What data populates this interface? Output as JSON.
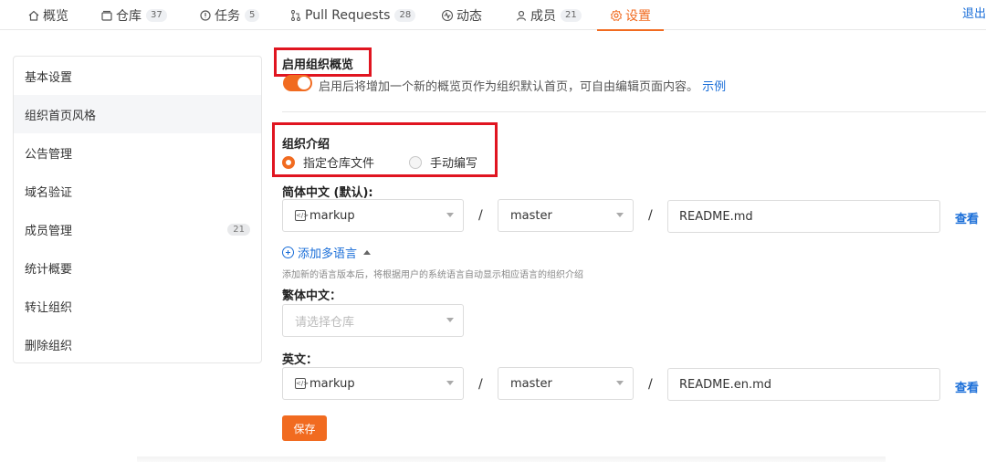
{
  "nav": {
    "tabs": [
      {
        "label": "概览",
        "icon": "home-icon",
        "count": ""
      },
      {
        "label": "仓库",
        "icon": "repo-icon",
        "count": "37"
      },
      {
        "label": "任务",
        "icon": "issue-icon",
        "count": "5"
      },
      {
        "label": "Pull Requests",
        "icon": "pull-request-icon",
        "count": "28"
      },
      {
        "label": "动态",
        "icon": "activity-icon",
        "count": ""
      },
      {
        "label": "成员",
        "icon": "user-icon",
        "count": "21"
      },
      {
        "label": "设置",
        "icon": "gear-icon",
        "count": ""
      }
    ],
    "logout": "退出"
  },
  "sidebar": {
    "items": [
      {
        "label": "基本设置"
      },
      {
        "label": "组织首页风格"
      },
      {
        "label": "公告管理"
      },
      {
        "label": "域名验证"
      },
      {
        "label": "成员管理",
        "count": "21"
      },
      {
        "label": "统计概要"
      },
      {
        "label": "转让组织"
      },
      {
        "label": "删除组织"
      }
    ]
  },
  "overview": {
    "title": "启用组织概览",
    "desc": "启用后将增加一个新的概览页作为组织默认首页，可自由编辑页面内容。",
    "example_link": "示例"
  },
  "intro": {
    "title": "组织介绍",
    "option_file": "指定仓库文件",
    "option_manual": "手动编写"
  },
  "simplified": {
    "label": "简体中文 (默认):",
    "repo": "markup",
    "branch": "master",
    "file": "README.md",
    "view": "查看"
  },
  "add_language": {
    "label": "添加多语言",
    "hint": "添加新的语言版本后，将根据用户的系统语言自动显示相应语言的组织介绍"
  },
  "traditional": {
    "label": "繁体中文：",
    "placeholder": "请选择仓库"
  },
  "english": {
    "label": "英文：",
    "repo": "markup",
    "branch": "master",
    "file": "README.en.md",
    "view": "查看"
  },
  "separator": "/",
  "save_label": "保存",
  "colors": {
    "accent": "#f16b20",
    "link": "#1a6ed8",
    "highlight_box": "#e01520"
  }
}
